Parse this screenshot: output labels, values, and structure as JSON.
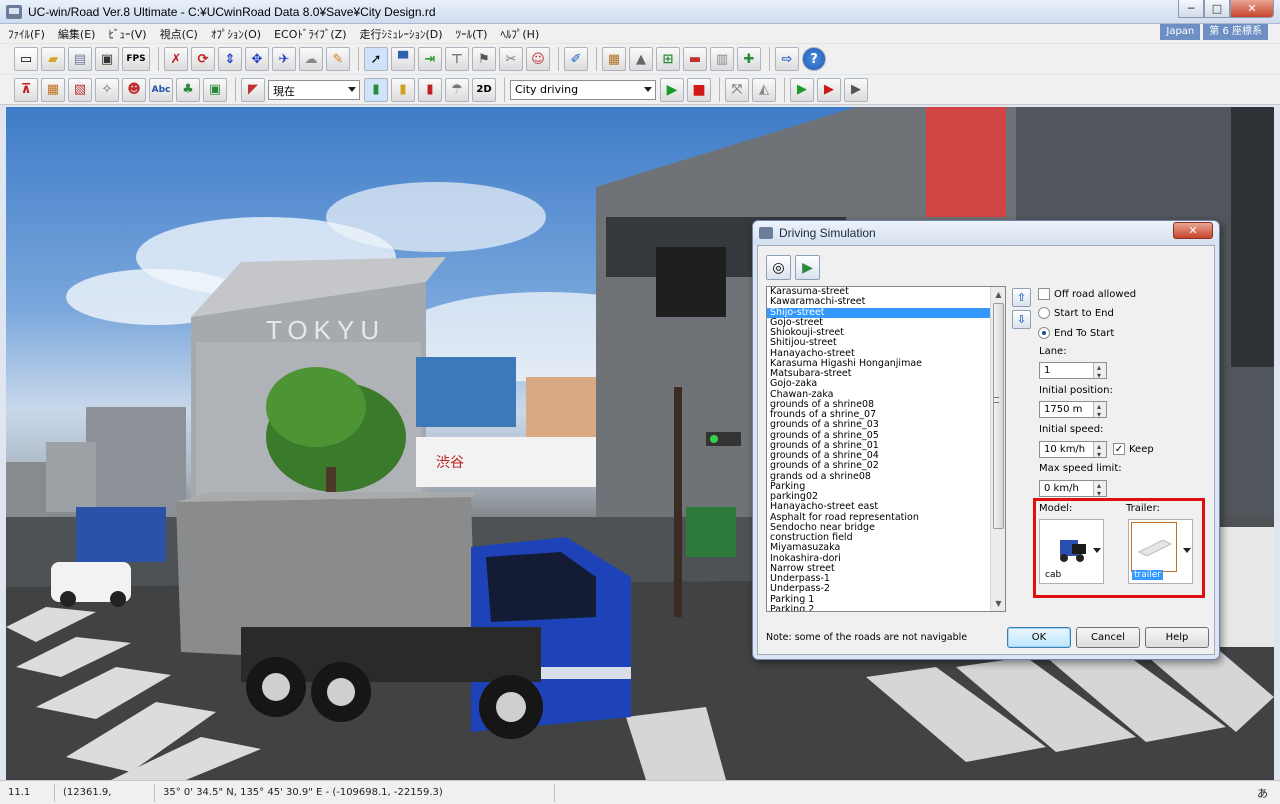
{
  "window": {
    "title": "UC-win/Road Ver.8 Ultimate - C:¥UCwinRoad Data 8.0¥Save¥City Design.rd",
    "minimize": "─",
    "maximize": "□",
    "close": "✕"
  },
  "menu": [
    "ﾌｧｲﾙ(F)",
    "編集(E)",
    "ﾋﾞｭｰ(V)",
    "視点(C)",
    "ｵﾌﾟｼｮﾝ(O)",
    "ECOﾄﾞﾗｲﾌﾞ(Z)",
    "走行ｼﾐｭﾚｰｼｮﾝ(D)",
    "ﾂｰﾙ(T)",
    "ﾍﾙﾌﾟ(H)"
  ],
  "lang": {
    "region": "Japan",
    "coord": "第 6 座標系"
  },
  "toolbar1": {
    "fps_label": "FPS",
    "icons": [
      "new-file-icon",
      "open-folder-icon",
      "database-icon",
      "save-icon",
      "fps-icon",
      "road-edit-icon",
      "rotate-icon",
      "move-vertical-icon",
      "move-icon",
      "plane-icon",
      "cloud-icon",
      "paint-icon",
      "select-icon",
      "car-icon",
      "gate-icon",
      "crane-icon",
      "flag-icon",
      "tools-icon",
      "person-icon",
      "pen-icon",
      "grid-icon",
      "road-icon",
      "sign-icon",
      "vehicle-icon",
      "document-icon",
      "add-icon",
      "export-icon",
      "help-icon"
    ]
  },
  "toolbar2": {
    "time_combo": "現在",
    "scenario_combo": "City driving",
    "label_2d": "2D",
    "abc_label": "Abc"
  },
  "statusbar": {
    "fps": "11.1 fps",
    "coords": "(12361.9, 10061.2)",
    "latlon": "35° 0' 34.5\" N, 135° 45' 30.9\" E  -  (-109698.1, -22159.3)",
    "ime": "あ"
  },
  "dialog": {
    "title": "Driving Simulation",
    "close": "✕",
    "roads": [
      "Karasuma-street",
      "Kawaramachi-street",
      "Shijo-street",
      "Gojo-street",
      "Shiokouji-street",
      "Shitijou-street",
      "Hanayacho-street",
      "Karasuma Higashi Honganjimae",
      "Matsubara-street",
      "Gojo-zaka",
      "Chawan-zaka",
      "grounds of a shrine08",
      "frounds of a shrine_07",
      "grounds of a shrine_03",
      "grounds of a shrine_05",
      "grounds of a shrine_01",
      "grounds of a shrine_04",
      "grounds of a shrine_02",
      "grands od a shrine08",
      "Parking",
      "parking02",
      "Hanayacho-street east",
      "Asphalt for road representation",
      "Sendocho near bridge",
      "construction field",
      "Miyamasuzaka",
      "Inokashira-dori",
      "Narrow street",
      "Underpass-1",
      "Underpass-2",
      "Parking 1",
      "Parking 2"
    ],
    "selected_road": "Shijo-street",
    "off_road": "Off road allowed",
    "start_to_end": "Start to End",
    "end_to_start": "End To Start",
    "lane_label": "Lane:",
    "lane_value": "1",
    "init_pos_label": "Initial position:",
    "init_pos_value": "1750 m",
    "init_speed_label": "Initial speed:",
    "init_speed_value": "10 km/h",
    "keep_label": "Keep",
    "max_speed_label": "Max speed limit:",
    "max_speed_value": "0 km/h",
    "model_label": "Model:",
    "model_name": "cab",
    "trailer_label": "Trailer:",
    "trailer_name": "trailer",
    "note": "Note: some of the roads are not navigable",
    "ok": "OK",
    "cancel": "Cancel",
    "help": "Help"
  }
}
